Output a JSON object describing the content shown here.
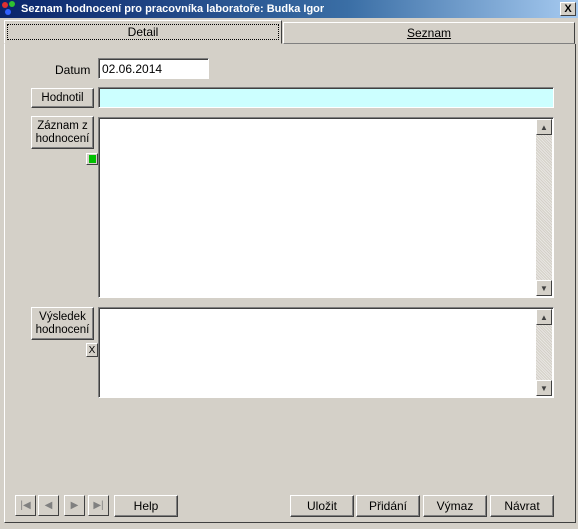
{
  "window": {
    "title": "Seznam hodnocení pro pracovníka laboratoře: Budka Igor",
    "close": "X"
  },
  "tabs": [
    {
      "label": "Detail",
      "selected": true
    },
    {
      "label": "Seznam",
      "selected": false
    }
  ],
  "form": {
    "datum_label": "Datum",
    "datum_value": "02.06.2014",
    "hodnotil_button": "Hodnotil",
    "hodnotil_value": "",
    "zaznam_button_line1": "Záznam z",
    "zaznam_button_line2": "hodnocení",
    "zaznam_value": "",
    "vysledek_button_line1": "Výsledek",
    "vysledek_button_line2": "hodnocení",
    "vysledek_clear": "X",
    "vysledek_value": ""
  },
  "footer": {
    "help": "Help",
    "ulozit": "Uložit",
    "pridani": "Přidání",
    "vymaz": "Výmaz",
    "navrat": "Návrat"
  },
  "colors": {
    "hodnotil_field_bg": "#ccffff",
    "indicator_green": "#00c000",
    "title_bar": "#0a246a"
  }
}
